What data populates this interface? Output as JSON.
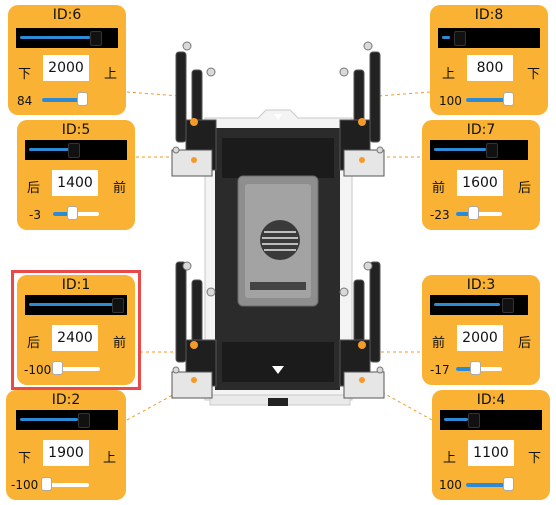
{
  "panels": {
    "id6": {
      "title": "ID:6",
      "left_label": "下",
      "right_label": "上",
      "value": "2000",
      "offset": "84",
      "bar": 0.83,
      "slider": 0.95
    },
    "id5": {
      "title": "ID:5",
      "left_label": "后",
      "right_label": "前",
      "value": "1400",
      "offset": "-3",
      "bar": 0.47,
      "slider": 0.4
    },
    "id1": {
      "title": "ID:1",
      "left_label": "后",
      "right_label": "前",
      "value": "2400",
      "offset": "-100",
      "bar": 0.95,
      "slider": 0.0
    },
    "id2": {
      "title": "ID:2",
      "left_label": "下",
      "right_label": "上",
      "value": "1900",
      "offset": "-100",
      "bar": 0.74,
      "slider": 0.0
    },
    "id8": {
      "title": "ID:8",
      "left_label": "上",
      "right_label": "下",
      "value": "800",
      "offset": "100",
      "bar": 0.12,
      "slider": 1.0
    },
    "id7": {
      "title": "ID:7",
      "left_label": "前",
      "right_label": "后",
      "value": "1600",
      "offset": "-23",
      "bar": 0.57,
      "slider": 0.3
    },
    "id3": {
      "title": "ID:3",
      "left_label": "前",
      "right_label": "后",
      "value": "2000",
      "offset": "-17",
      "bar": 0.74,
      "slider": 0.32
    },
    "id4": {
      "title": "ID:4",
      "left_label": "上",
      "right_label": "下",
      "value": "1100",
      "offset": "100",
      "bar": 0.32,
      "slider": 1.0
    }
  },
  "colors": {
    "panel": "#f9b233",
    "bar": "#2d8bd6",
    "highlight": "#e84a4a",
    "leader": "#f39a2a"
  }
}
